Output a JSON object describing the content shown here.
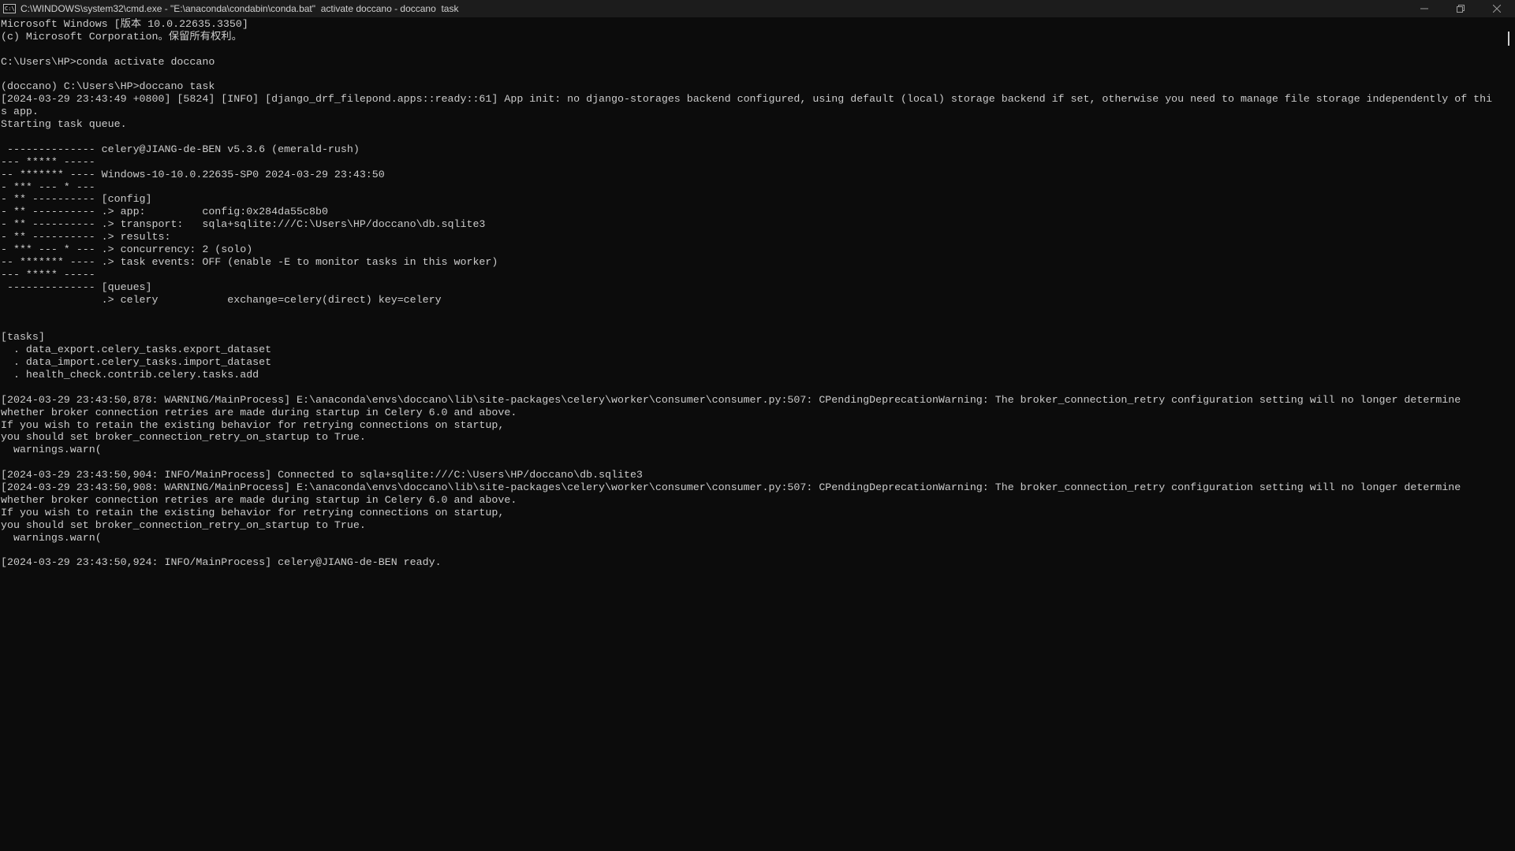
{
  "window": {
    "title": "C:\\WINDOWS\\system32\\cmd.exe - \"E:\\anaconda\\condabin\\conda.bat\"  activate doccano - doccano  task",
    "icon_glyph": "C:\\"
  },
  "console": {
    "lines": [
      "Microsoft Windows [版本 10.0.22635.3350]",
      "(c) Microsoft Corporation。保留所有权利。",
      "",
      "C:\\Users\\HP>conda activate doccano",
      "",
      "(doccano) C:\\Users\\HP>doccano task",
      "[2024-03-29 23:43:49 +0800] [5824] [INFO] [django_drf_filepond.apps::ready::61] App init: no django-storages backend configured, using default (local) storage backend if set, otherwise you need to manage file storage independently of thi",
      "s app.",
      "Starting task queue.",
      "",
      " -------------- celery@JIANG-de-BEN v5.3.6 (emerald-rush)",
      "--- ***** -----",
      "-- ******* ---- Windows-10-10.0.22635-SP0 2024-03-29 23:43:50",
      "- *** --- * ---",
      "- ** ---------- [config]",
      "- ** ---------- .> app:         config:0x284da55c8b0",
      "- ** ---------- .> transport:   sqla+sqlite:///C:\\Users\\HP/doccano\\db.sqlite3",
      "- ** ---------- .> results:",
      "- *** --- * --- .> concurrency: 2 (solo)",
      "-- ******* ---- .> task events: OFF (enable -E to monitor tasks in this worker)",
      "--- ***** -----",
      " -------------- [queues]",
      "                .> celery           exchange=celery(direct) key=celery",
      "",
      "",
      "[tasks]",
      "  . data_export.celery_tasks.export_dataset",
      "  . data_import.celery_tasks.import_dataset",
      "  . health_check.contrib.celery.tasks.add",
      "",
      "[2024-03-29 23:43:50,878: WARNING/MainProcess] E:\\anaconda\\envs\\doccano\\lib\\site-packages\\celery\\worker\\consumer\\consumer.py:507: CPendingDeprecationWarning: The broker_connection_retry configuration setting will no longer determine",
      "whether broker connection retries are made during startup in Celery 6.0 and above.",
      "If you wish to retain the existing behavior for retrying connections on startup,",
      "you should set broker_connection_retry_on_startup to True.",
      "  warnings.warn(",
      "",
      "[2024-03-29 23:43:50,904: INFO/MainProcess] Connected to sqla+sqlite:///C:\\Users\\HP/doccano\\db.sqlite3",
      "[2024-03-29 23:43:50,908: WARNING/MainProcess] E:\\anaconda\\envs\\doccano\\lib\\site-packages\\celery\\worker\\consumer\\consumer.py:507: CPendingDeprecationWarning: The broker_connection_retry configuration setting will no longer determine",
      "whether broker connection retries are made during startup in Celery 6.0 and above.",
      "If you wish to retain the existing behavior for retrying connections on startup,",
      "you should set broker_connection_retry_on_startup to True.",
      "  warnings.warn(",
      "",
      "[2024-03-29 23:43:50,924: INFO/MainProcess] celery@JIANG-de-BEN ready."
    ]
  },
  "colors": {
    "background": "#0c0c0c",
    "text": "#cccccc",
    "titlebar": "#1c1c1c"
  },
  "icons": {
    "minimize": "minimize-icon",
    "restore": "restore-icon",
    "close": "close-icon"
  }
}
